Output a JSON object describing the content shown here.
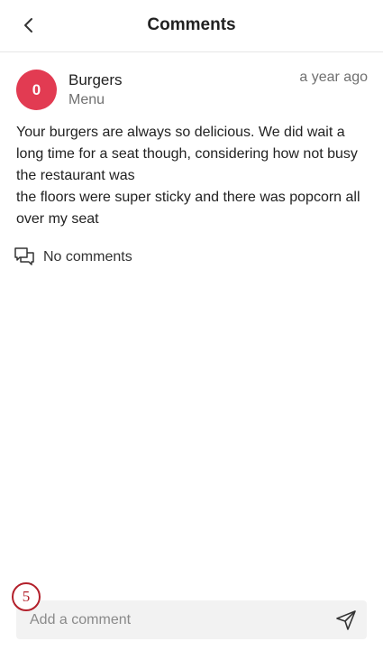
{
  "header": {
    "title": "Comments",
    "back_icon": "chevron-left-icon"
  },
  "post": {
    "avatar_text": "0",
    "avatar_color": "#e23b52",
    "name": "Burgers",
    "source": "Menu",
    "time": "a year ago",
    "body": [
      "Your burgers are always so delicious. We did wait a long time for a seat though, considering how not busy the restaurant was",
      "the floors were super sticky and there was popcorn all over my seat"
    ]
  },
  "comments": {
    "icon": "speech-bubbles-icon",
    "label": "No comments"
  },
  "step_badge": {
    "text": "5",
    "color": "#b3202b"
  },
  "composer": {
    "placeholder": "Add a comment",
    "value": "",
    "send_icon": "send-icon"
  }
}
